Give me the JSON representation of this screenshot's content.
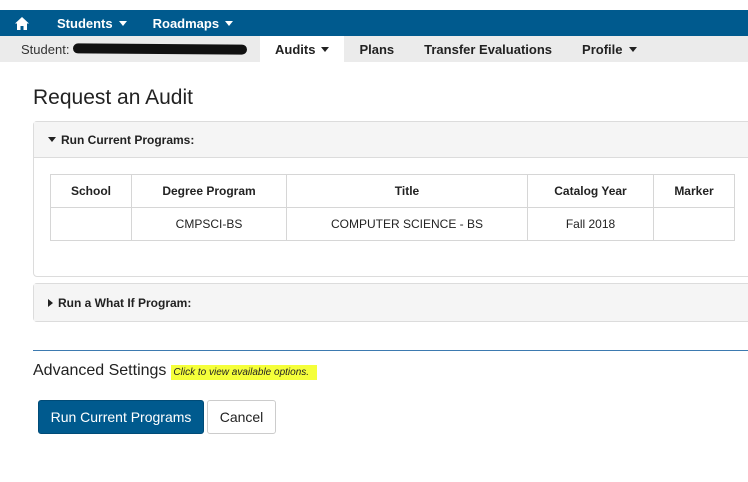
{
  "topnav": {
    "home_icon": "home-icon",
    "items": [
      {
        "label": "Students"
      },
      {
        "label": "Roadmaps"
      }
    ]
  },
  "subnav": {
    "student_label": "Student:",
    "tabs": [
      {
        "label": "Audits",
        "active": true,
        "dropdown": true
      },
      {
        "label": "Plans",
        "active": false,
        "dropdown": false
      },
      {
        "label": "Transfer Evaluations",
        "active": false,
        "dropdown": false
      },
      {
        "label": "Profile",
        "active": false,
        "dropdown": true
      }
    ]
  },
  "page": {
    "title": "Request an Audit"
  },
  "current_programs": {
    "header": "Run Current Programs:",
    "columns": [
      "School",
      "Degree Program",
      "Title",
      "Catalog Year",
      "Marker"
    ],
    "rows": [
      [
        "",
        "CMPSCI-BS",
        "COMPUTER SCIENCE - BS",
        "Fall 2018",
        ""
      ]
    ]
  },
  "what_if": {
    "header": "Run a What If Program:"
  },
  "advanced": {
    "label": "Advanced Settings",
    "hint": "Click to view available options."
  },
  "actions": {
    "run_label": "Run Current Programs",
    "cancel_label": "Cancel"
  },
  "colors": {
    "brand": "#005a8e",
    "subnav_bg": "#ebebeb",
    "highlight": "#f5ff3a"
  }
}
